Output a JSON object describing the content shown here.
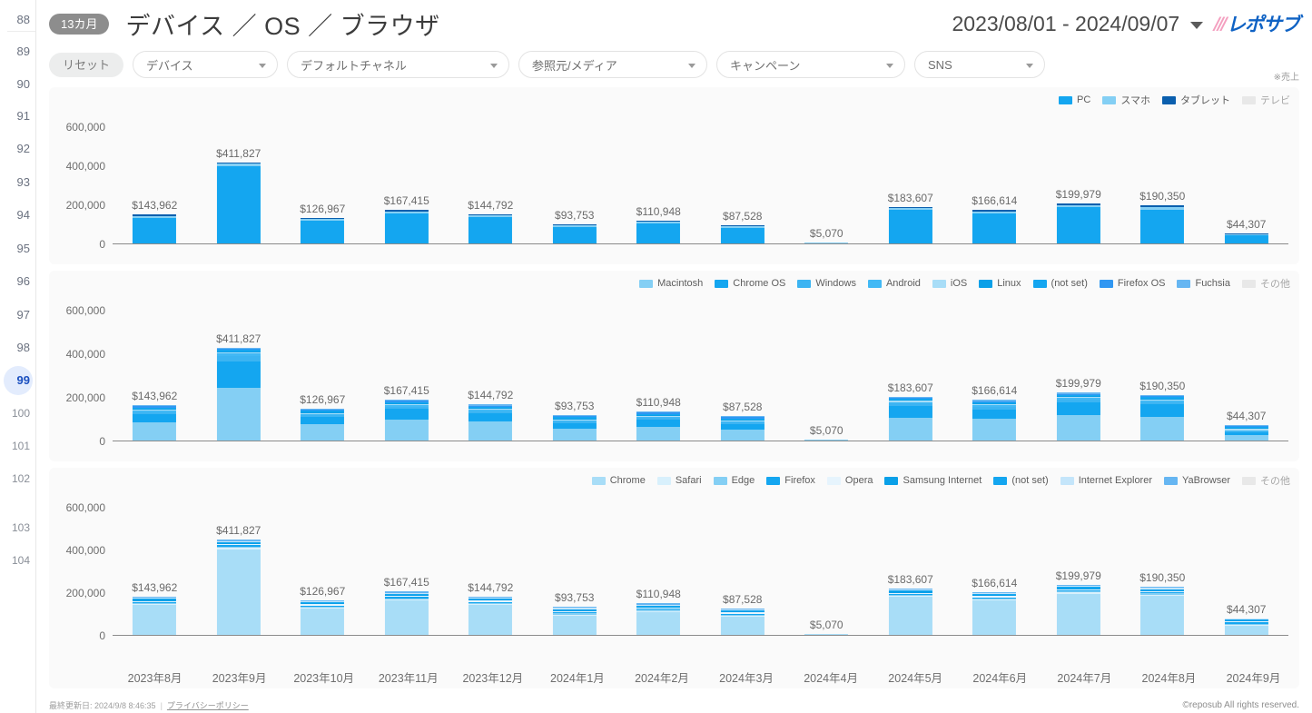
{
  "gutter": {
    "numbers": [
      88,
      89,
      90,
      91,
      92,
      93,
      94,
      95,
      96,
      97,
      98,
      99,
      100,
      101,
      102,
      103,
      104
    ],
    "active": 99
  },
  "header": {
    "badge": "13カ月",
    "title": "デバイス ／ OS ／ ブラウザ",
    "date_range": "2023/08/01 - 2024/09/07",
    "caret_icon": "chevron-down-icon",
    "logo_text": "レポサブ",
    "logo_slashes": "///"
  },
  "filters": {
    "reset_label": "リセット",
    "note": "※売上",
    "selects": [
      {
        "label": "デバイス"
      },
      {
        "label": "デフォルトチャネル"
      },
      {
        "label": "参照元/メディア"
      },
      {
        "label": "キャンペーン"
      },
      {
        "label": "SNS"
      }
    ]
  },
  "footer": {
    "updated": "最終更新日: 2024/9/8 8:46:35",
    "separator": "|",
    "privacy": "プライバシーポリシー",
    "copyright": "©reposub All rights reserved."
  },
  "chart_data": [
    {
      "type": "bar",
      "id": "device",
      "title": "デバイス",
      "stacked": true,
      "grid": false,
      "legend_position": "top-right",
      "ylim": [
        0,
        600000
      ],
      "yticks": [
        0,
        200000,
        400000,
        600000
      ],
      "ytick_labels": [
        "0",
        "200,000",
        "400,000",
        "600,000"
      ],
      "categories": [
        "2023年8月",
        "2023年9月",
        "2023年10月",
        "2023年11月",
        "2023年12月",
        "2024年1月",
        "2024年2月",
        "2024年3月",
        "2024年4月",
        "2024年5月",
        "2024年6月",
        "2024年7月",
        "2024年8月",
        "2024年9月"
      ],
      "totals": [
        143962,
        411827,
        126967,
        167415,
        144792,
        93753,
        110948,
        87528,
        5070,
        183607,
        166614,
        199979,
        190350,
        44307
      ],
      "total_labels": [
        "$143,962",
        "$411,827",
        "$126,967",
        "$167,415",
        "$144,792",
        "$93,753",
        "$110,948",
        "$87,528",
        "$5,070",
        "$183,607",
        "$166,614",
        "$199,979",
        "$190,350",
        "$44,307"
      ],
      "series": [
        {
          "name": "PC",
          "color": "#14a6f0",
          "values": [
            132000,
            395000,
            117000,
            155000,
            133000,
            86000,
            101000,
            80000,
            0,
            170000,
            152000,
            186000,
            174000,
            41000
          ]
        },
        {
          "name": "スマホ",
          "color": "#84cff4",
          "values": [
            9500,
            13000,
            8000,
            10000,
            10000,
            6500,
            8500,
            6500,
            5070,
            11500,
            12500,
            11500,
            14000,
            3000
          ]
        },
        {
          "name": "タブレット",
          "color": "#0a5fae",
          "values": [
            2462,
            3827,
            1967,
            2415,
            1792,
            1253,
            1448,
            1028,
            0,
            2107,
            2114,
            2479,
            2350,
            307
          ]
        },
        {
          "name": "テレビ",
          "color": "#e8e8e8",
          "values": [
            0,
            0,
            0,
            0,
            0,
            0,
            0,
            0,
            0,
            0,
            0,
            0,
            0,
            0
          ]
        }
      ]
    },
    {
      "type": "bar",
      "id": "os",
      "title": "OS",
      "stacked": true,
      "grid": false,
      "legend_position": "top-right",
      "ylim": [
        0,
        600000
      ],
      "yticks": [
        0,
        200000,
        400000,
        600000
      ],
      "ytick_labels": [
        "0",
        "200,000",
        "400,000",
        "600,000"
      ],
      "categories": [
        "2023年8月",
        "2023年9月",
        "2023年10月",
        "2023年11月",
        "2023年12月",
        "2024年1月",
        "2024年2月",
        "2024年3月",
        "2024年4月",
        "2024年5月",
        "2024年6月",
        "2024年7月",
        "2024年8月",
        "2024年9月"
      ],
      "totals": [
        143962,
        411827,
        126967,
        167415,
        144792,
        93753,
        110948,
        87528,
        5070,
        183607,
        166614,
        199979,
        190350,
        44307
      ],
      "total_labels": [
        "$143,962",
        "$411,827",
        "$126,967",
        "$167,415",
        "$144,792",
        "$93,753",
        "$110,948",
        "$87,528",
        "$5,070",
        "$183,607",
        "$166,614",
        "$199,979",
        "$190,350",
        "$44,307"
      ],
      "series": [
        {
          "name": "Macintosh",
          "color": "#84cff4",
          "values": [
            83000,
            243000,
            76000,
            97000,
            86000,
            55000,
            64000,
            51000,
            5070,
            104000,
            98000,
            116000,
            110000,
            26000
          ]
        },
        {
          "name": "Chrome OS",
          "color": "#14a6f0",
          "values": [
            40000,
            120000,
            33000,
            47000,
            39000,
            26000,
            32000,
            25000,
            0,
            53000,
            45000,
            58000,
            55000,
            12000
          ]
        },
        {
          "name": "Windows",
          "color": "#3cb4f2",
          "values": [
            8000,
            24000,
            8000,
            11000,
            9000,
            6000,
            7000,
            6000,
            0,
            12000,
            11000,
            13000,
            12000,
            3000
          ]
        },
        {
          "name": "Android",
          "color": "#42b9f5",
          "values": [
            6000,
            12000,
            5000,
            7000,
            6000,
            3500,
            4500,
            3000,
            0,
            8000,
            7000,
            7500,
            7000,
            2000
          ]
        },
        {
          "name": "iOS",
          "color": "#a8ddf7",
          "values": [
            3500,
            6000,
            2500,
            3000,
            2500,
            1500,
            2000,
            1500,
            0,
            3500,
            3000,
            3000,
            3500,
            800
          ]
        },
        {
          "name": "Linux",
          "color": "#0aa0e8",
          "values": [
            2000,
            4000,
            1500,
            1700,
            1400,
            900,
            1100,
            700,
            0,
            2000,
            1800,
            1800,
            1900,
            400
          ]
        },
        {
          "name": "(not set)",
          "color": "#14a6f0",
          "values": [
            900,
            1800,
            700,
            800,
            600,
            450,
            500,
            200,
            0,
            800,
            700,
            500,
            800,
            80
          ]
        },
        {
          "name": "Firefox OS",
          "color": "#3097f2",
          "values": [
            400,
            700,
            200,
            500,
            200,
            250,
            300,
            100,
            0,
            200,
            100,
            150,
            200,
            20
          ]
        },
        {
          "name": "Fuchsia",
          "color": "#66b6f2",
          "values": [
            162,
            327,
            67,
            415,
            92,
            153,
            48,
            28,
            0,
            107,
            14,
            29,
            50,
            7
          ]
        },
        {
          "name": "その他",
          "color": "#e8e8e8",
          "values": [
            0,
            0,
            0,
            0,
            0,
            0,
            0,
            0,
            0,
            0,
            0,
            0,
            0,
            0
          ]
        }
      ]
    },
    {
      "type": "bar",
      "id": "browser",
      "title": "ブラウザ",
      "stacked": true,
      "grid": false,
      "legend_position": "top-right",
      "ylim": [
        0,
        600000
      ],
      "yticks": [
        0,
        200000,
        400000,
        600000
      ],
      "ytick_labels": [
        "0",
        "200,000",
        "400,000",
        "600,000"
      ],
      "categories": [
        "2023年8月",
        "2023年9月",
        "2023年10月",
        "2023年11月",
        "2023年12月",
        "2024年1月",
        "2024年2月",
        "2024年3月",
        "2024年4月",
        "2024年5月",
        "2024年6月",
        "2024年7月",
        "2024年8月",
        "2024年9月"
      ],
      "totals": [
        143962,
        411827,
        126967,
        167415,
        144792,
        93753,
        110948,
        87528,
        5070,
        183607,
        166614,
        199979,
        190350,
        44307
      ],
      "total_labels": [
        "$143,962",
        "$411,827",
        "$126,967",
        "$167,415",
        "$144,792",
        "$93,753",
        "$110,948",
        "$87,528",
        "$5,070",
        "$183,607",
        "$166,614",
        "$199,979",
        "$190,350",
        "$44,307"
      ],
      "series": [
        {
          "name": "Chrome",
          "color": "#a8ddf7",
          "values": [
            139000,
            402000,
            123000,
            162000,
            140000,
            90500,
            107000,
            84500,
            5070,
            177500,
            161000,
            193500,
            184000,
            42800
          ]
        },
        {
          "name": "Safari",
          "color": "#d8f0fc",
          "values": [
            3500,
            7500,
            3000,
            4000,
            3500,
            2300,
            3000,
            2200,
            0,
            4700,
            4500,
            5000,
            4800,
            1100
          ]
        },
        {
          "name": "Edge",
          "color": "#84cff4",
          "values": [
            800,
            1500,
            600,
            900,
            700,
            500,
            600,
            500,
            0,
            900,
            700,
            900,
            1000,
            250
          ]
        },
        {
          "name": "Firefox",
          "color": "#14a6f0",
          "values": [
            400,
            500,
            250,
            300,
            350,
            250,
            200,
            200,
            0,
            300,
            250,
            350,
            350,
            100
          ]
        },
        {
          "name": "Opera",
          "color": "#e6f4fd",
          "values": [
            150,
            200,
            80,
            130,
            130,
            100,
            100,
            80,
            0,
            120,
            100,
            150,
            130,
            40
          ]
        },
        {
          "name": "Samsung Internet",
          "color": "#0aa0e8",
          "values": [
            60,
            80,
            20,
            50,
            60,
            50,
            30,
            30,
            0,
            50,
            40,
            50,
            40,
            10
          ]
        },
        {
          "name": "(not set)",
          "color": "#14a6f0",
          "values": [
            30,
            30,
            10,
            20,
            30,
            30,
            10,
            10,
            0,
            20,
            15,
            20,
            20,
            5
          ]
        },
        {
          "name": "Internet Explorer",
          "color": "#c4e5fa",
          "values": [
            15,
            12,
            5,
            10,
            15,
            15,
            5,
            5,
            0,
            10,
            6,
            6,
            8,
            2
          ]
        },
        {
          "name": "YaBrowser",
          "color": "#66b6f2",
          "values": [
            7,
            5,
            2,
            5,
            7,
            8,
            3,
            3,
            0,
            7,
            3,
            3,
            2,
            0
          ]
        },
        {
          "name": "その他",
          "color": "#e8e8e8",
          "values": [
            0,
            0,
            0,
            0,
            0,
            0,
            0,
            0,
            0,
            0,
            0,
            0,
            0,
            0
          ]
        }
      ]
    }
  ]
}
